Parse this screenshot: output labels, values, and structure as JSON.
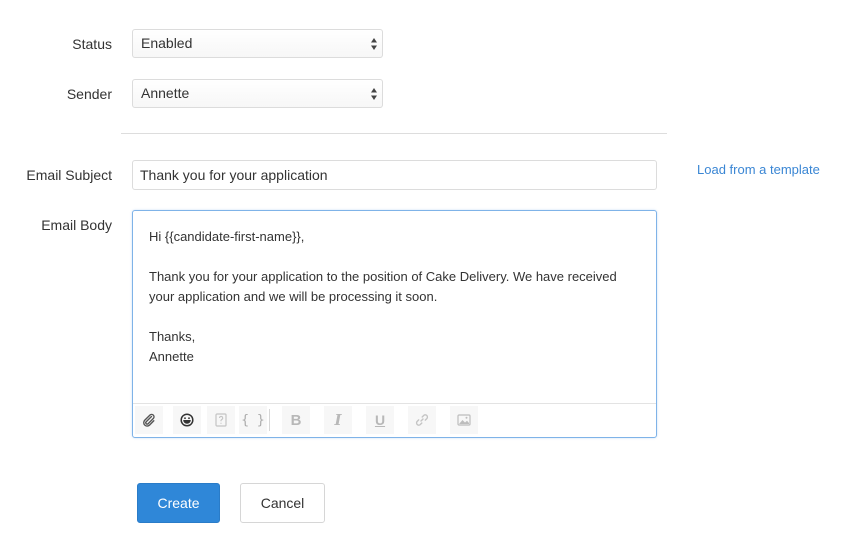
{
  "form": {
    "status": {
      "label": "Status",
      "value": "Enabled"
    },
    "sender": {
      "label": "Sender",
      "value": "Annette"
    },
    "email_subject": {
      "label": "Email Subject",
      "value": "Thank you for your application"
    },
    "load_template_link": "Load from a template",
    "email_body": {
      "label": "Email Body",
      "paragraphs": [
        "Hi {{candidate-first-name}},",
        "Thank you for your application to the position of Cake Delivery. We have received your application and we will be processing it soon.",
        "Thanks,"
      ],
      "signature": "Annette"
    },
    "toolbar": [
      {
        "icon": "paperclip-icon"
      },
      {
        "icon": "emoji-icon"
      },
      {
        "icon": "help-icon"
      },
      {
        "icon": "curly-braces-icon",
        "text": "{ }"
      },
      {
        "icon": "bold-icon",
        "text": "B"
      },
      {
        "icon": "italic-icon",
        "text": "I"
      },
      {
        "icon": "underline-icon",
        "text": "U"
      },
      {
        "icon": "link-icon"
      },
      {
        "icon": "image-icon"
      }
    ]
  },
  "actions": {
    "create_label": "Create",
    "cancel_label": "Cancel"
  },
  "colors": {
    "primary": "#2f87d8",
    "link": "#3a86d4",
    "editor_focus_border": "#7fb3e8"
  }
}
